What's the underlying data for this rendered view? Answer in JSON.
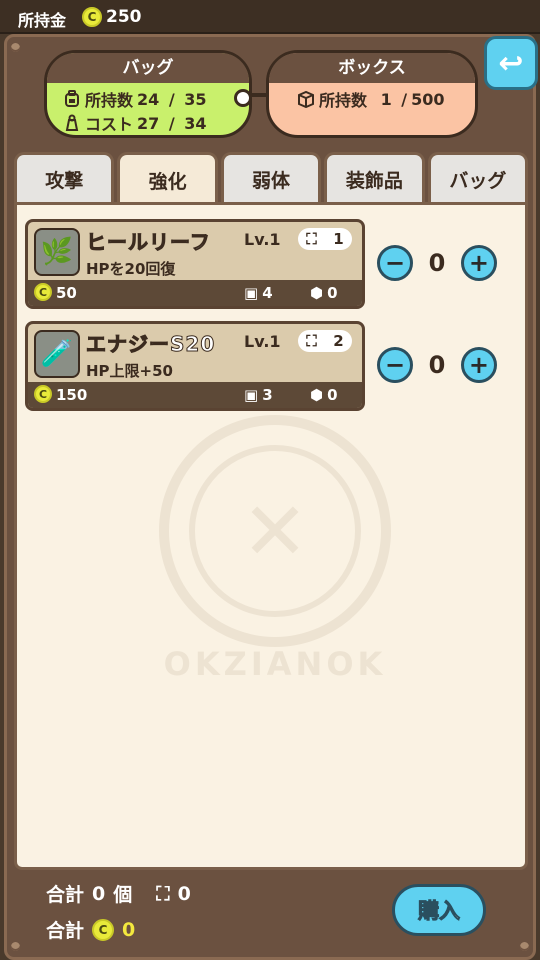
{
  "header": {
    "money_label": "所持金",
    "coin_symbol": "C",
    "money": "250"
  },
  "bag": {
    "title": "バッグ",
    "held_label": "所持数",
    "held": "24",
    "held_max": "35",
    "cost_label": "コスト",
    "cost": "27",
    "cost_max": "34"
  },
  "box": {
    "title": "ボックス",
    "held_label": "所持数",
    "held": "1",
    "held_max": "500"
  },
  "tabs": [
    {
      "label": "攻撃",
      "active": false
    },
    {
      "label": "強化",
      "active": true
    },
    {
      "label": "弱体",
      "active": false
    },
    {
      "label": "装飾品",
      "active": false
    },
    {
      "label": "バッグ",
      "active": false
    }
  ],
  "items": [
    {
      "name": "ヒールリーフ",
      "level": "Lv.1",
      "cost": "1",
      "desc": "HPを20回復",
      "price": "50",
      "stock": "4",
      "box": "0",
      "qty": "0",
      "icon": "leaf-icon"
    },
    {
      "name": "エナジーS20",
      "level": "Lv.1",
      "cost": "2",
      "desc": "HP上限+50",
      "price": "150",
      "stock": "3",
      "box": "0",
      "qty": "0",
      "icon": "potion-bottle-icon"
    }
  ],
  "watermark": {
    "text": "OKZIANOK"
  },
  "footer": {
    "total_label": "合計",
    "total_count": "0",
    "count_unit": "個",
    "total_cost": "0",
    "total_price": "0",
    "buy_label": "購入"
  },
  "colors": {
    "accent": "#5fd1f0",
    "bag_pill": "#c9f06c",
    "box_pill": "#fbc4a4",
    "frame": "#6b5140",
    "panel": "#faf2e3"
  }
}
